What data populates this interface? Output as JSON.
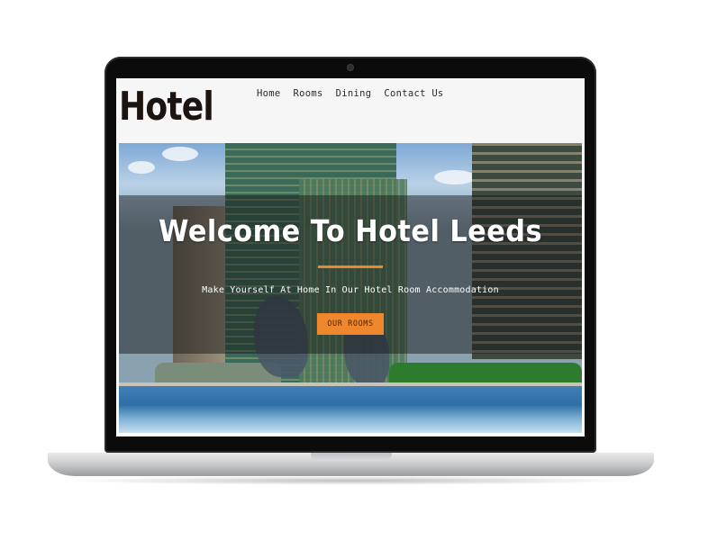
{
  "site": {
    "logo_text": "Hotel",
    "nav": [
      {
        "label": "Home"
      },
      {
        "label": "Rooms"
      },
      {
        "label": "Dining"
      },
      {
        "label": "Contact Us"
      }
    ]
  },
  "hero": {
    "title": "Welcome To Hotel Leeds",
    "subtitle": "Make Yourself At Home In Our Hotel Room Accommodation",
    "cta_label": "OUR ROOMS"
  },
  "colors": {
    "accent": "#f0872c",
    "logo": "#1c1410",
    "header_bg": "#f6f6f6"
  }
}
